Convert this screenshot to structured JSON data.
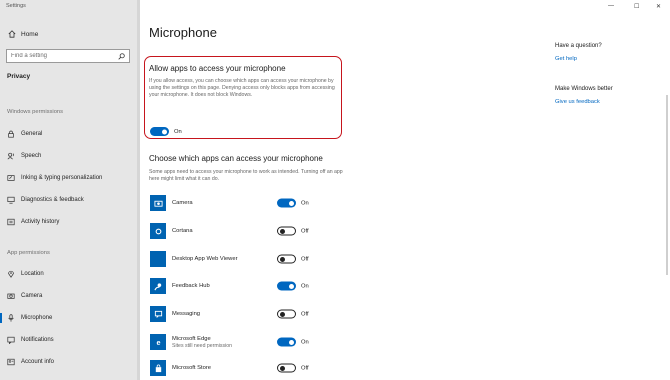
{
  "window": {
    "title": "Settings",
    "minimize": "—",
    "maximize": "☐",
    "close": "✕"
  },
  "sidebar": {
    "home": "Home",
    "search_placeholder": "Find a setting",
    "section_title": "Privacy",
    "windows_perm_heading": "Windows permissions",
    "windows_items": [
      {
        "label": "General",
        "icon": "lock-icon"
      },
      {
        "label": "Speech",
        "icon": "speech-icon"
      },
      {
        "label": "Inking & typing personalization",
        "icon": "inking-icon"
      },
      {
        "label": "Diagnostics & feedback",
        "icon": "diagnostics-icon"
      },
      {
        "label": "Activity history",
        "icon": "activity-icon"
      }
    ],
    "app_perm_heading": "App permissions",
    "app_items": [
      {
        "label": "Location",
        "icon": "location-icon"
      },
      {
        "label": "Camera",
        "icon": "camera-icon"
      },
      {
        "label": "Microphone",
        "icon": "microphone-icon",
        "selected": true
      },
      {
        "label": "Notifications",
        "icon": "notifications-icon"
      },
      {
        "label": "Account info",
        "icon": "account-icon"
      }
    ]
  },
  "main": {
    "title": "Microphone",
    "allow": {
      "heading": "Allow apps to access your microphone",
      "description": "If you allow access, you can choose which apps can access your microphone by using the settings on this page. Denying access only blocks apps from accessing your microphone. It does not block Windows.",
      "state": "On"
    },
    "choose": {
      "heading": "Choose which apps can access your microphone",
      "description": "Some apps need to access your microphone to work as intended. Turning off an app here might limit what it can do."
    },
    "apps": [
      {
        "name": "Camera",
        "sub": "",
        "state": "On",
        "on": true
      },
      {
        "name": "Cortana",
        "sub": "",
        "state": "Off",
        "on": false
      },
      {
        "name": "Desktop App Web Viewer",
        "sub": "",
        "state": "Off",
        "on": false
      },
      {
        "name": "Feedback Hub",
        "sub": "",
        "state": "On",
        "on": true
      },
      {
        "name": "Messaging",
        "sub": "",
        "state": "Off",
        "on": false
      },
      {
        "name": "Microsoft Edge",
        "sub": "Sites still need permission",
        "state": "On",
        "on": true
      },
      {
        "name": "Microsoft Store",
        "sub": "",
        "state": "Off",
        "on": false
      }
    ]
  },
  "right_panel": {
    "question_heading": "Have a question?",
    "get_help": "Get help",
    "better_heading": "Make Windows better",
    "feedback": "Give us feedback"
  },
  "colors": {
    "accent": "#0067c0",
    "highlight_border": "#c6151d",
    "sidebar_bg": "#e6e6e6"
  }
}
